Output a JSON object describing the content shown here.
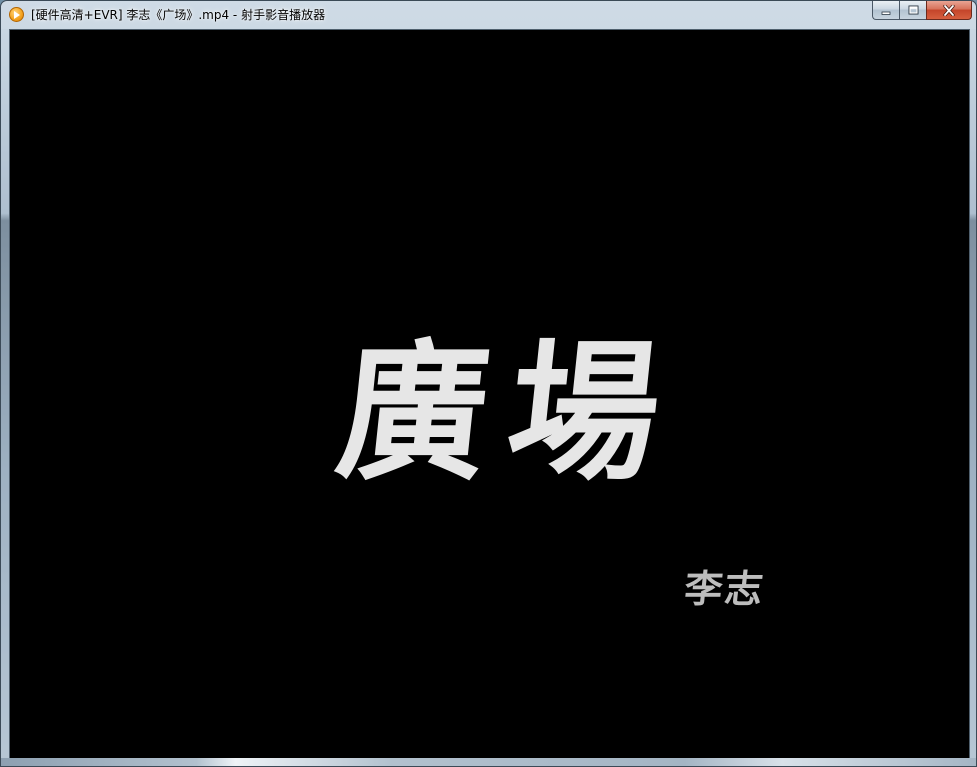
{
  "window": {
    "title": "[硬件高清+EVR] 李志《广场》.mp4 - 射手影音播放器",
    "app_icon": "play-icon",
    "buttons": {
      "minimize": "minimize-icon",
      "maximize": "maximize-icon",
      "close": "close-icon"
    }
  },
  "video": {
    "frame_title": "廣場",
    "frame_artist": "李志",
    "background": "#000000",
    "text_color": "#e6e6e6"
  },
  "colors": {
    "close_button": "#c4452a",
    "app_icon": "#f5a623"
  }
}
